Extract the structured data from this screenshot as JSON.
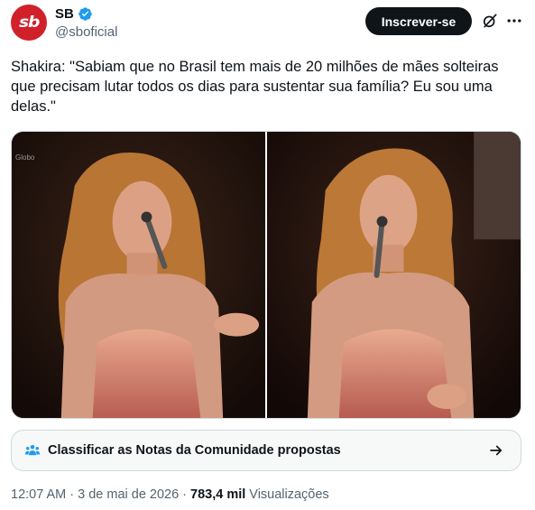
{
  "author": {
    "avatar_text": "sb",
    "display_name": "SB",
    "handle": "@sboficial",
    "verified": true
  },
  "header": {
    "subscribe_label": "Inscrever-se",
    "grok_icon": "grok-slash-icon",
    "more_icon": "more-dots-icon"
  },
  "tweet": {
    "text": "Shakira: \"Sabiam que no Brasil tem mais de 20 milhões de mães solteiras que precisam lutar todos os dias para sustentar sua família? Eu sou uma delas.\"",
    "photo_watermark": "Globo"
  },
  "community_notes": {
    "label": "Classificar as Notas da Comunidade propostas",
    "icon": "people-icon"
  },
  "meta": {
    "time": "12:07 AM",
    "separator1": "·",
    "date": "3 de mai de 2026",
    "separator2": "·",
    "views_count": "783,4 mil",
    "views_label": "Visualizações"
  },
  "colors": {
    "brand_red": "#d0202a",
    "verified_blue": "#1d9bf0",
    "text_primary": "#0f1419",
    "text_secondary": "#536471"
  }
}
